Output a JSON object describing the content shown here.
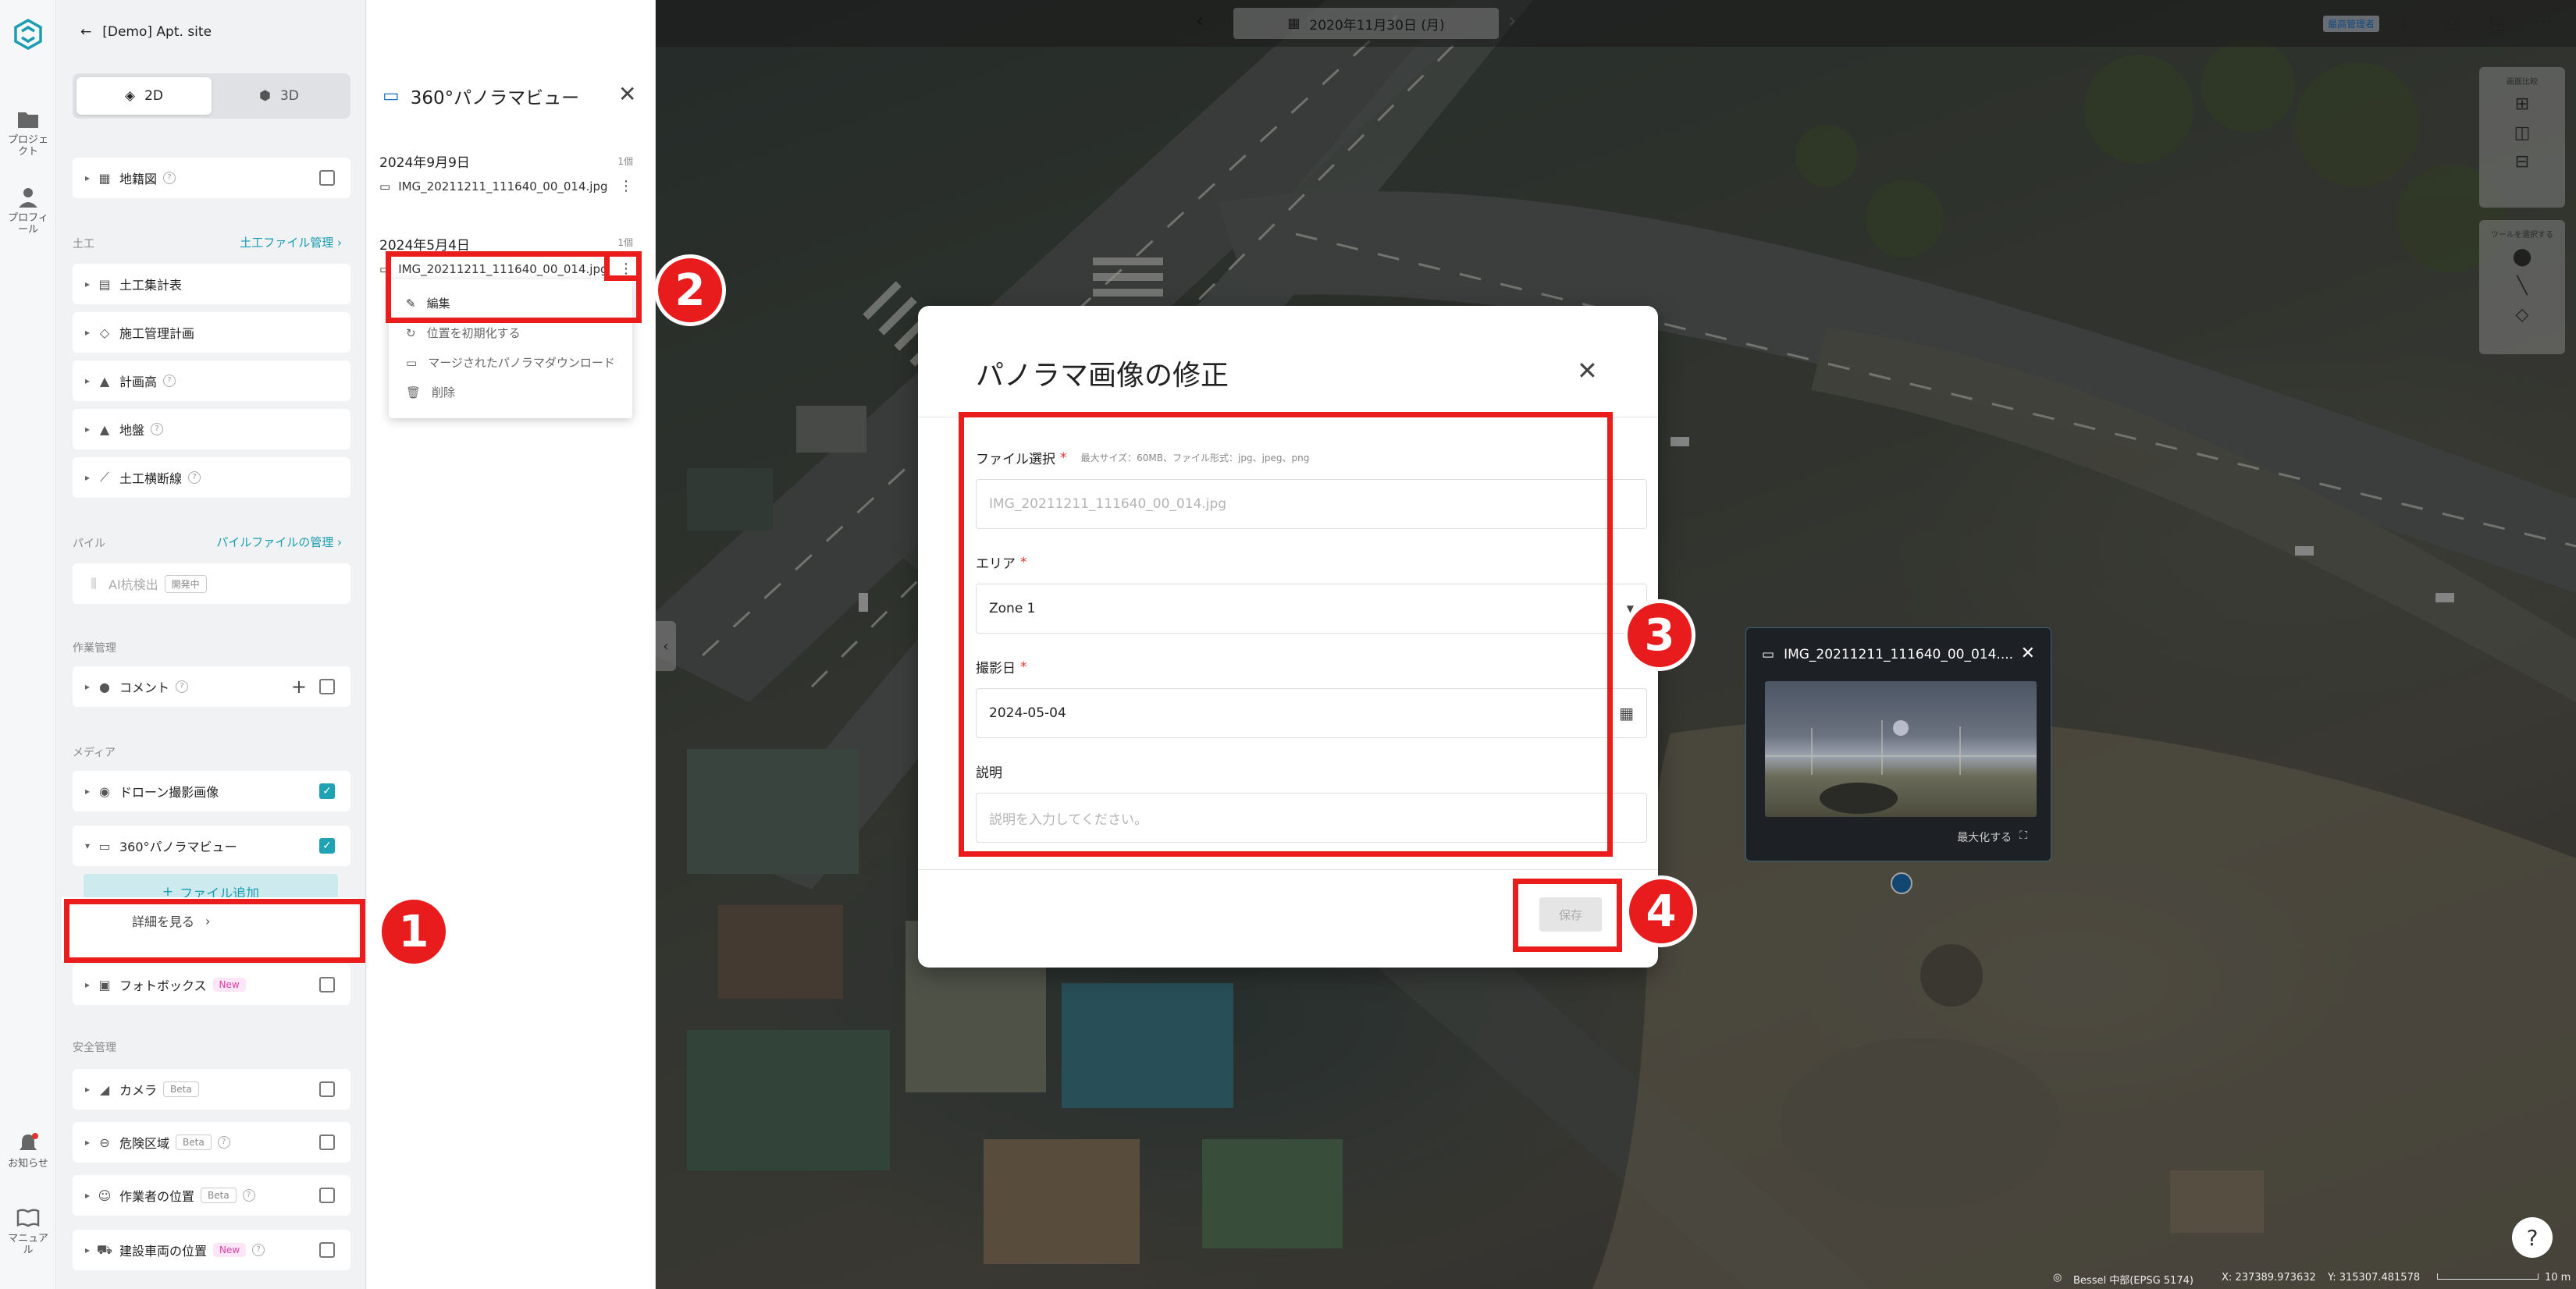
{
  "rail": {
    "items": [
      {
        "label": "プロジェクト",
        "icon": "folder-icon"
      },
      {
        "label": "プロフィール",
        "icon": "person-icon"
      },
      {
        "label": "お知らせ",
        "icon": "bell-icon"
      },
      {
        "label": "マニュアル",
        "icon": "book-icon"
      }
    ]
  },
  "sidebar": {
    "back_label": "[Demo] Apt. site",
    "view_toggle": {
      "two_d": "2D",
      "three_d": "3D",
      "active": "2D"
    },
    "cadastral": "地籍図",
    "section_earthwork": "土工",
    "link_earthwork": "土工ファイル管理",
    "earthwork_items": [
      "土工集計表",
      "施工管理計画",
      "計画高",
      "地盤",
      "土工横断線"
    ],
    "section_pile": "パイル",
    "link_pile": "パイルファイルの管理",
    "pile_item": "AI杭検出",
    "pile_badge": "開発中",
    "section_work": "作業管理",
    "comment": "コメント",
    "section_media": "メディア",
    "drone": "ドローン撮影画像",
    "pano": "360°パノラマビュー",
    "add_file": "ファイル追加",
    "detail": "詳細を見る",
    "photobox": "フォトボックス",
    "badge_new": "New",
    "section_safety": "安全管理",
    "camera": "カメラ",
    "badge_beta": "Beta",
    "danger": "危険区域",
    "worker": "作業者の位置",
    "vehicle": "建設車両の位置"
  },
  "pano_panel": {
    "title": "360°パノラマビュー",
    "groups": [
      {
        "date": "2024年9月9日",
        "count": "1個",
        "file": "IMG_20211211_111640_00_014.jpg"
      },
      {
        "date": "2024年5月4日",
        "count": "1個",
        "file": "IMG_20211211_111640_00_014.jpg"
      }
    ],
    "menu": [
      "編集",
      "位置を初期化する",
      "マージされたパノラマダウンロード",
      "削除"
    ]
  },
  "map": {
    "date": "2020年11月30日 (月)",
    "top_badge": "最高管理者",
    "tool_label_1": "画面比較",
    "tool_label_2": "ツールを選択する",
    "status_crs": "Bessel 中部(EPSG 5174)",
    "status_x": "X: 237389.973632",
    "status_y": "Y: 315307.481578",
    "scale": "10 m",
    "help": "?"
  },
  "dialog": {
    "title": "パノラマ画像の修正",
    "file_label": "ファイル選択",
    "file_hint": "最大サイズ：60MB、ファイル形式：jpg、jpeg、png",
    "file_value": "IMG_20211211_111640_00_014.jpg",
    "area_label": "エリア",
    "area_value": "Zone 1",
    "date_label": "撮影日",
    "date_value": "2024-05-04",
    "desc_label": "説明",
    "desc_placeholder": "説明を入力してください。",
    "save": "保存"
  },
  "preview": {
    "title": "IMG_20211211_111640_00_014....",
    "maximize": "最大化する"
  },
  "callouts": [
    "1",
    "2",
    "3",
    "4"
  ]
}
